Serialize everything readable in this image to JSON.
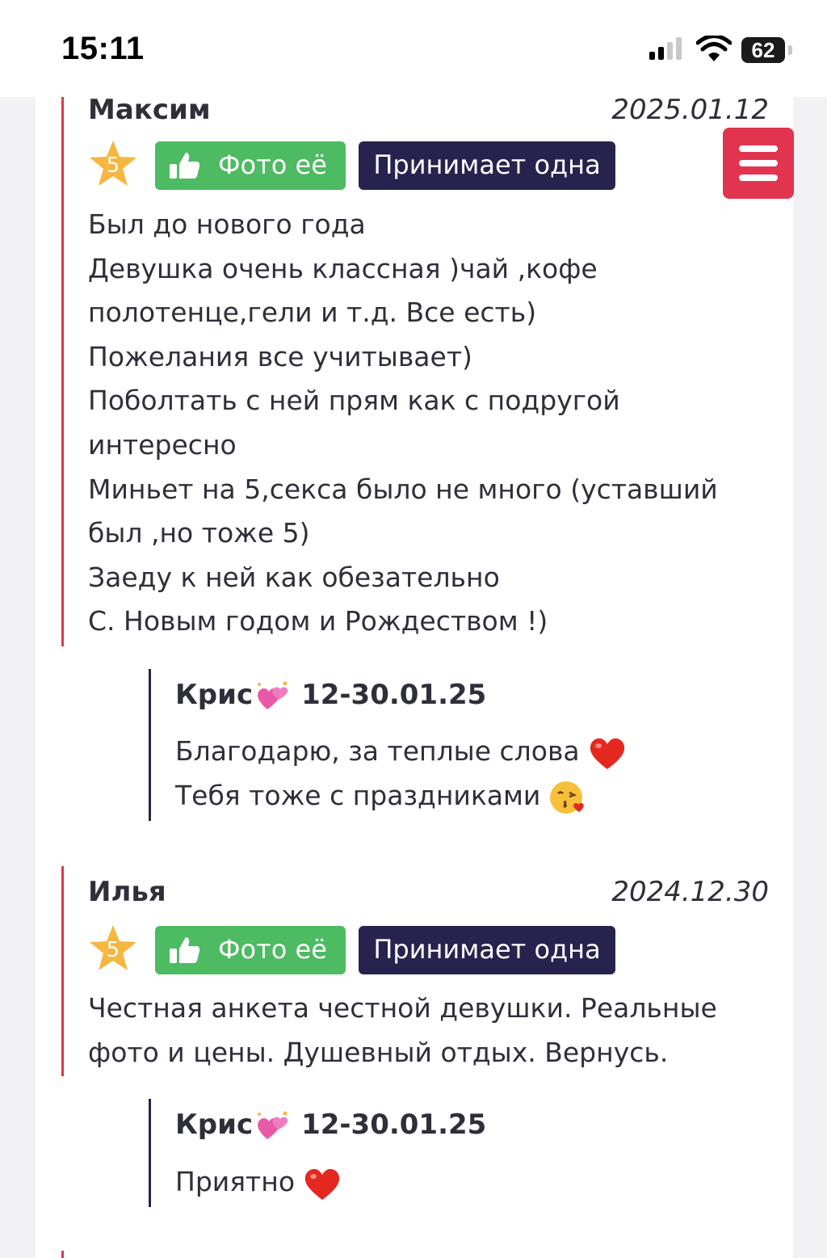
{
  "status_bar": {
    "time": "15:11",
    "battery": "62"
  },
  "colors": {
    "accent_red": "#e0344f",
    "photo_green": "#4dbb62",
    "navy": "#27234e",
    "star_gold": "#f6b640"
  },
  "reviews": [
    {
      "author": "Максим",
      "date": "2025.01.12",
      "rating": "5",
      "photo_label": "Фото её",
      "alone_label": "Принимает одна",
      "lines": [
        "Был до нового года",
        "Девушка очень классная )чай ,кофе",
        "полотенце,гели и т.д. Все есть)",
        "Пожелания все учитывает)",
        "Поболтать с ней прям как с подругой",
        "интересно",
        "Миньет на 5,секса было не много (уставший",
        "был ,но тоже 5)",
        "Заеду к ней как обезательно",
        "С. Новым годом и Рождеством !)"
      ],
      "reply": {
        "author": "Крис",
        "date": "12-30.01.25",
        "lines": [
          "Благодарю, за теплые слова",
          "Тебя тоже с праздниками"
        ]
      }
    },
    {
      "author": "Илья",
      "date": "2024.12.30",
      "rating": "5",
      "photo_label": "Фото её",
      "alone_label": "Принимает одна",
      "lines": [
        "Честная анкета честной девушки. Реальные",
        "фото и цены. Душевный отдых. Вернусь."
      ],
      "reply": {
        "author": "Крис",
        "date": "12-30.01.25",
        "lines": [
          "Приятно"
        ]
      }
    }
  ]
}
